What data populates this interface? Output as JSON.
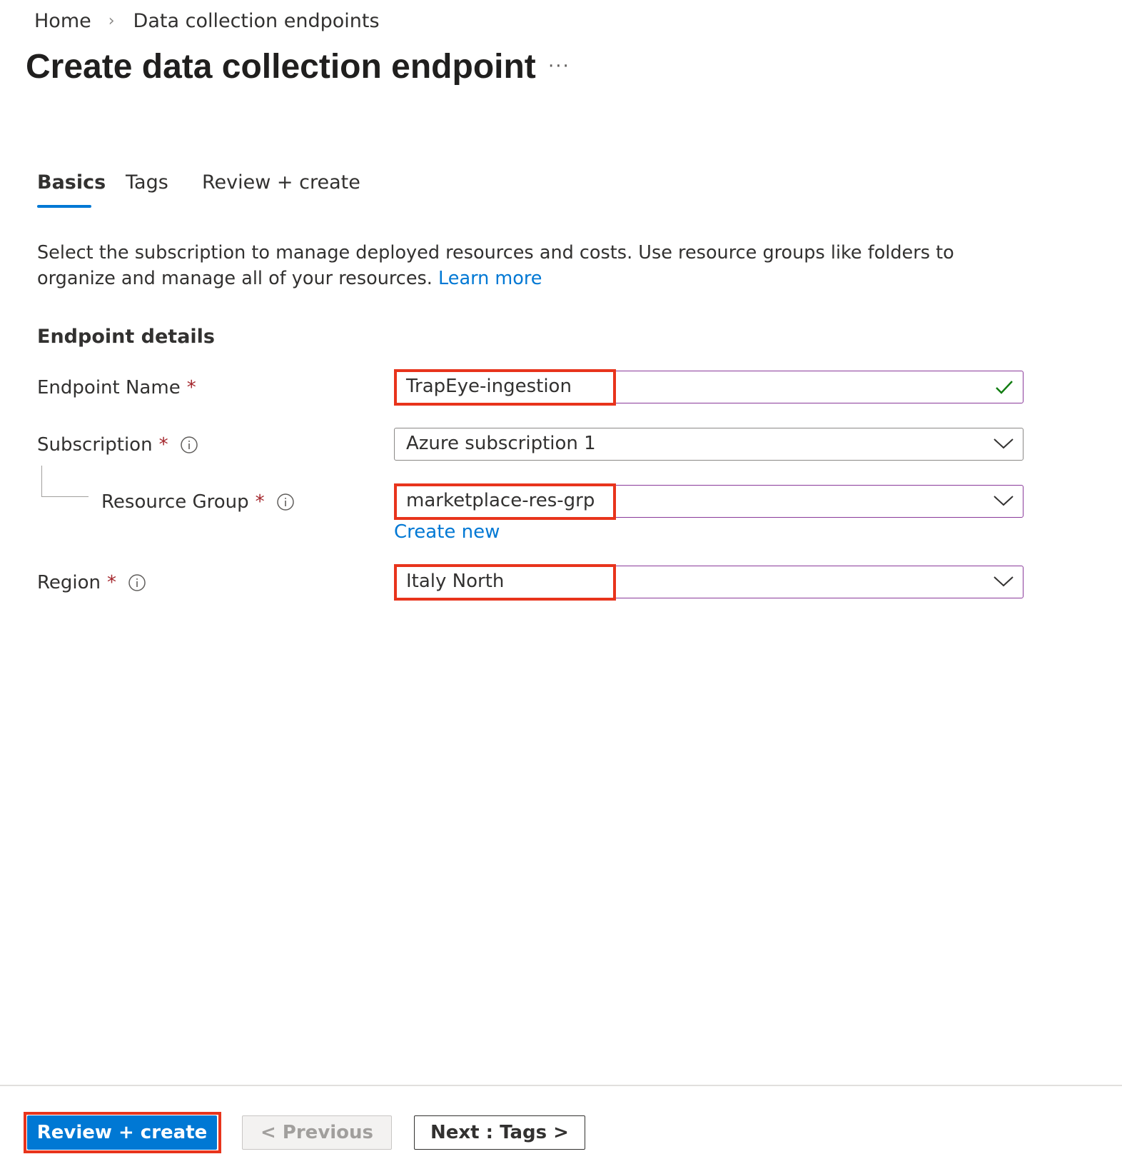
{
  "breadcrumb": {
    "home": "Home",
    "separator": "›",
    "current": "Data collection endpoints"
  },
  "page": {
    "title": "Create data collection endpoint",
    "more_label": "···"
  },
  "tabs": [
    {
      "label": "Basics",
      "active": true
    },
    {
      "label": "Tags",
      "active": false
    },
    {
      "label": "Review + create",
      "active": false
    }
  ],
  "intro": {
    "text": "Select the subscription to manage deployed resources and costs. Use resource groups like folders to organize and manage all of your resources.",
    "link": "Learn more"
  },
  "section": {
    "title": "Endpoint details"
  },
  "form": {
    "endpoint_name": {
      "label": "Endpoint Name",
      "required": "*",
      "value": "TrapEye-ingestion",
      "status_icon": "checkmark-icon"
    },
    "subscription": {
      "label": "Subscription",
      "required": "*",
      "value": "Azure subscription 1"
    },
    "resource_group": {
      "label": "Resource Group",
      "required": "*",
      "value": "marketplace-res-grp",
      "create_new": "Create new"
    },
    "region": {
      "label": "Region",
      "required": "*",
      "value": "Italy North"
    }
  },
  "footer": {
    "primary": "Review + create",
    "previous": "< Previous",
    "next": "Next : Tags >"
  },
  "colors": {
    "accent": "#0078d4",
    "required": "#a4262c",
    "highlight": "#e8341c",
    "valid_check": "#107c10",
    "validated_border": "#8a3a9a"
  }
}
